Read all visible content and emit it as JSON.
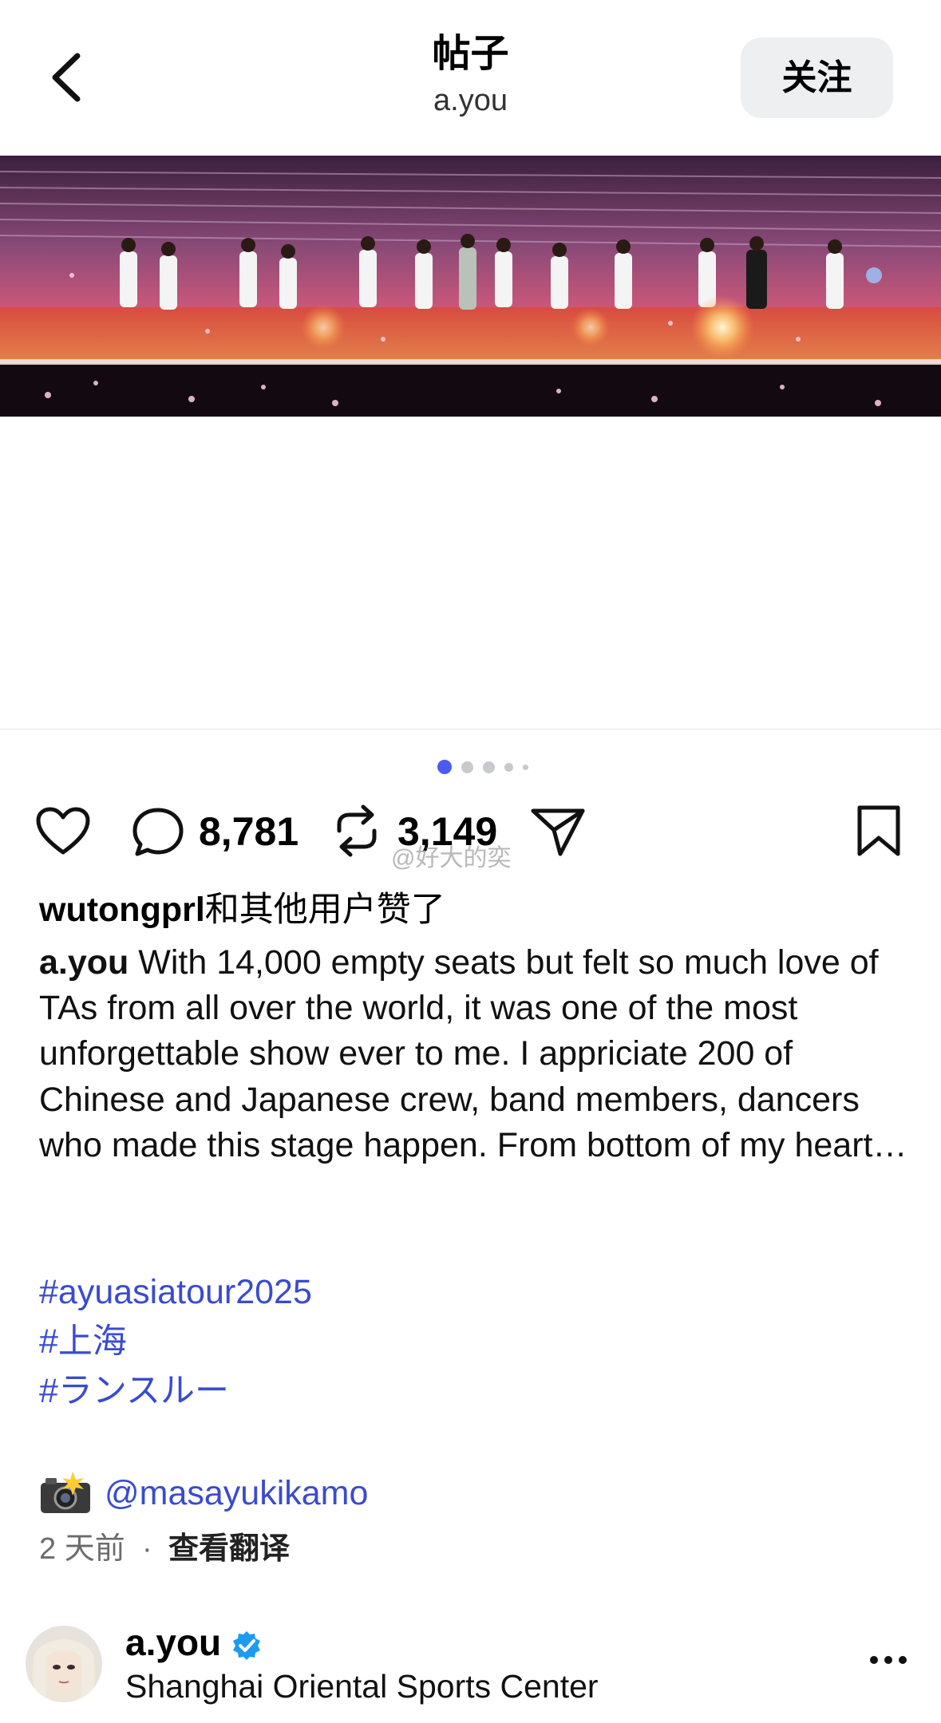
{
  "header": {
    "title": "帖子",
    "subtitle": "a.you",
    "follow_label": "关注"
  },
  "carousel": {
    "total": 5,
    "active_index": 0
  },
  "actions": {
    "comments_count": "8,781",
    "reposts_count": "3,149"
  },
  "watermark": "@好大的奕",
  "likes": {
    "username": "wutongprl",
    "suffix": "和其他用户赞了"
  },
  "caption": {
    "author": "a.you",
    "text": "With 14,000 empty seats but felt so much love of TAs from all over the world, it was one of the most unforgettable show ever to me. I appriciate 200 of Chinese and Japanese crew, band members, dancers who made this stage happen. From bottom of my heart…"
  },
  "hashtags": [
    "#ayuasiatour2025",
    "#上海",
    "#ランスルー"
  ],
  "photo_credit": {
    "emoji": "📸",
    "mention": "@masayukikamo"
  },
  "meta": {
    "time": "2 天前",
    "separator": "·",
    "translate_label": "查看翻译"
  },
  "account": {
    "name": "a.you",
    "location": "Shanghai Oriental Sports Center"
  },
  "colors": {
    "link": "#3a4bd0",
    "dot_active": "#4a5cf0",
    "verified": "#1d9bf0"
  }
}
